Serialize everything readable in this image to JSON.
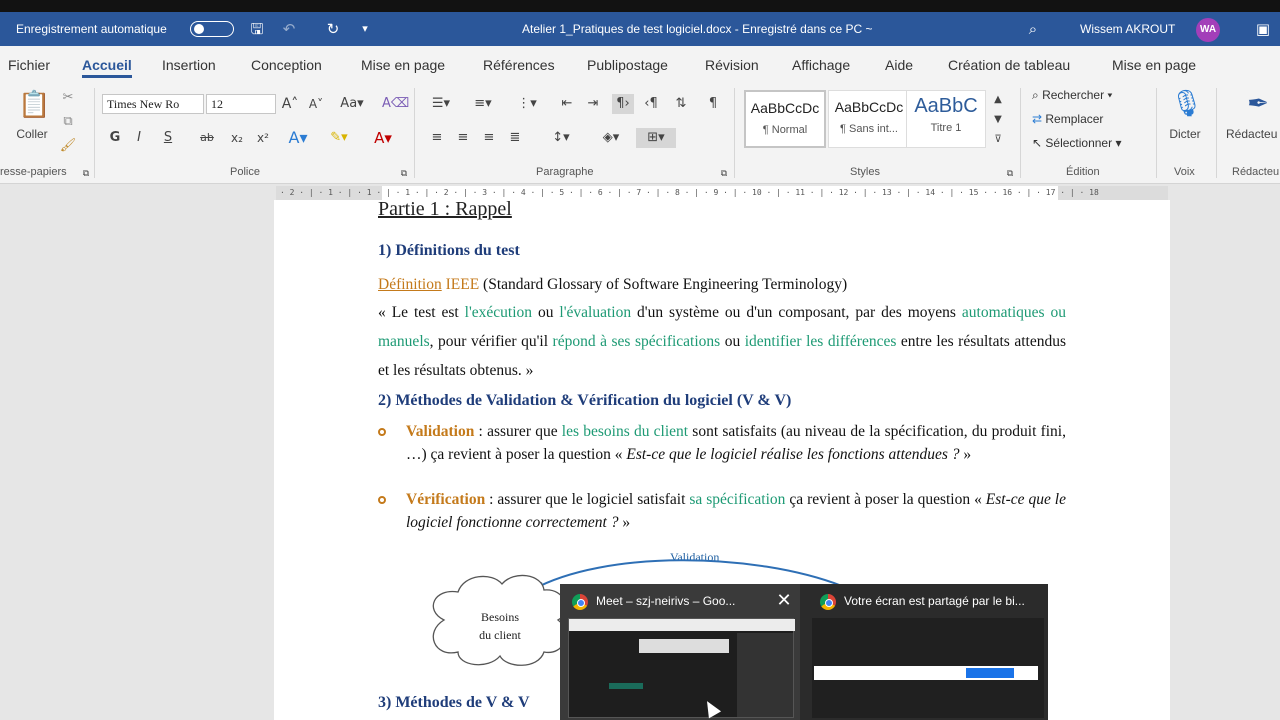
{
  "titlebar": {
    "autosave_label": "Enregistrement automatique",
    "doc_title": "Atelier 1_Pratiques de test logiciel.docx  -  Enregistré dans ce PC  ~",
    "user_name": "Wissem AKROUT",
    "user_initials": "WA"
  },
  "menu": {
    "tabs": [
      "Fichier",
      "Accueil",
      "Insertion",
      "Conception",
      "Mise en page",
      "Références",
      "Publipostage",
      "Révision",
      "Affichage",
      "Aide",
      "Création de tableau",
      "Mise en page"
    ]
  },
  "ribbon": {
    "clipboard": {
      "paste_label": "Coller",
      "group_label": "resse-papiers"
    },
    "font": {
      "font_name": "Times New Ro",
      "font_size": "12",
      "group_label": "Police",
      "bold": "G",
      "italic": "I",
      "underline": "S"
    },
    "paragraph": {
      "group_label": "Paragraphe"
    },
    "styles": {
      "group_label": "Styles",
      "items": [
        {
          "preview": "AaBbCcDc",
          "name": "¶ Normal"
        },
        {
          "preview": "AaBbCcDc",
          "name": "¶ Sans int..."
        },
        {
          "preview": "AaBbC",
          "name": "Titre 1"
        }
      ]
    },
    "editing": {
      "find": "Rechercher",
      "replace": "Remplacer",
      "select": "Sélectionner",
      "group_label": "Édition"
    },
    "voice": {
      "dictate": "Dicter",
      "group_label": "Voix"
    },
    "editor": {
      "label": "Rédacteu",
      "group_label": "Rédacteu"
    }
  },
  "ruler": {
    "text": "· 2 · | · 1 · | · 1 · | · 1 · | · 2 · | · 3 · | · 4 · | · 5 · | · 6 · | · 7 · | · 8 · | · 9 · | · 10 · | · 11 · | · 12 · | · 13 · | · 14 · | · 15 ·  · 16 · | · 17 · | · 18"
  },
  "document": {
    "part_title": "Partie 1 : Rappel",
    "section1": "1)  Définitions du test",
    "def_prefix": "Définition",
    "def_ieee": "IEEE",
    "def_rest": " (Standard Glossary of Software Engineering Terminology)",
    "quote_p1": "« Le test est ",
    "quote_execution": "l'exécution",
    "quote_p2": " ou ",
    "quote_evaluation": "l'évaluation",
    "quote_p3": " d'un système ou d'un composant, par des moyens ",
    "quote_auto": "automatiques ou manuels",
    "quote_p4": ", pour vérifier qu'il ",
    "quote_repond": "répond à ses spécifications",
    "quote_p5": " ou ",
    "quote_identifier": "identifier les différences",
    "quote_p6": " entre les résultats attendus et les résultats obtenus. »",
    "section2": "2)  Méthodes de Validation & Vérification du logiciel (V & V)",
    "val_label": "Validation",
    "val_p1": " : assurer que ",
    "val_besoins": "les besoins du client",
    "val_p2": " sont satisfaits (au niveau de la spécification, du produit fini, …) ça revient à poser la question « ",
    "val_q": "Est-ce que le logiciel réalise les fonctions attendues ?",
    "val_end": " »",
    "ver_label": "Vérification",
    "ver_p1": " : assurer que le logiciel satisfait ",
    "ver_spec": "sa spécification",
    "ver_p2": " ça revient à poser la question « ",
    "ver_q": "Est-ce que le logiciel fonctionne correctement ?",
    "ver_end": " »",
    "diagram_validation": "Validation",
    "cloud_text_1": "Besoins",
    "cloud_text_2": "du client",
    "section3": "3)  Méthodes de V & V"
  },
  "taskbar_popup": {
    "card1_title": "Meet – szj-neirivs – Goo...",
    "card2_title": "Votre écran est partagé par le bi..."
  }
}
